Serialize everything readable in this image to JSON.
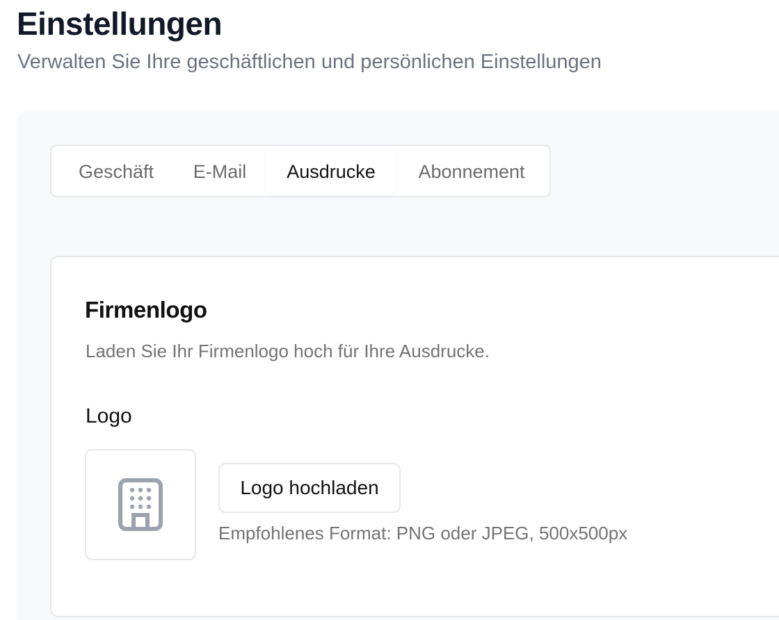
{
  "header": {
    "title": "Einstellungen",
    "subtitle": "Verwalten Sie Ihre geschäftlichen und persönlichen Einstellungen"
  },
  "tabs": [
    {
      "label": "Geschäft",
      "active": false
    },
    {
      "label": "E-Mail",
      "active": false
    },
    {
      "label": "Ausdrucke",
      "active": true
    },
    {
      "label": "Abonnement",
      "active": false
    }
  ],
  "card": {
    "title": "Firmenlogo",
    "description": "Laden Sie Ihr Firmenlogo hoch für Ihre Ausdrucke.",
    "logo_label": "Logo",
    "placeholder_icon": "building-icon",
    "upload_button_label": "Logo hochladen",
    "hint": "Empfohlenes Format: PNG oder JPEG, 500x500px"
  },
  "colors": {
    "title": "#111827",
    "muted_text": "#6b7280",
    "panel_background": "#f8f9fa",
    "border": "#e5e7eb",
    "icon": "#9ca3af"
  }
}
